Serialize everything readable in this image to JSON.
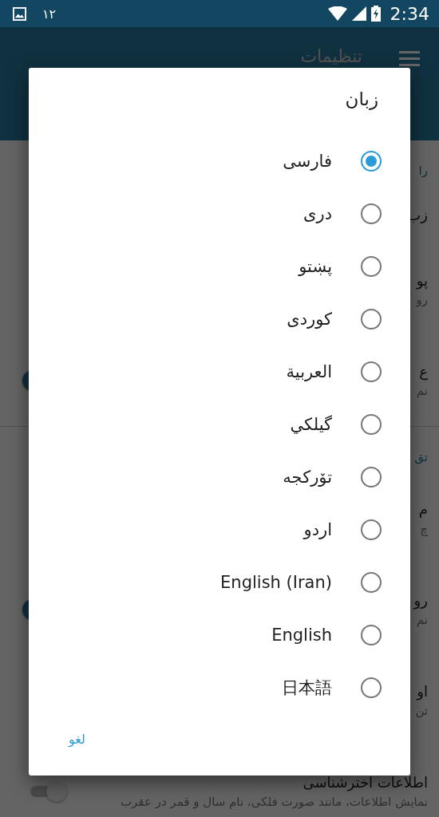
{
  "status_bar": {
    "notification_count": "۱۲",
    "time": "2:34"
  },
  "app_bar": {
    "title": "تنظیمات"
  },
  "settings": [
    {
      "header": "را",
      "items": [
        {
          "title": "زب"
        },
        {
          "title": "پو",
          "summary": "رو"
        },
        {
          "title": "ع",
          "summary": "نم",
          "toggle": {
            "on": true
          }
        }
      ]
    },
    {
      "header": "تق",
      "items": [
        {
          "title": "م",
          "summary": "چ"
        },
        {
          "title": "رو",
          "summary": "نم",
          "toggle": {
            "on": true
          }
        },
        {
          "title": "او",
          "summary": "تن"
        },
        {
          "title": "اطلاعات اخترشناسی",
          "summary": "نمایش اطلاعات، مانند صورت فلکی، نام سال و قمر در عقرب",
          "toggle": {
            "on": false
          }
        }
      ]
    }
  ],
  "dialog": {
    "title": "زبان",
    "options": [
      {
        "label": "فارسی",
        "selected": true
      },
      {
        "label": "دری",
        "selected": false
      },
      {
        "label": "پښتو",
        "selected": false
      },
      {
        "label": "کوردی",
        "selected": false
      },
      {
        "label": "العربية",
        "selected": false
      },
      {
        "label": "گیلکي",
        "selected": false
      },
      {
        "label": "تۆرکجه",
        "selected": false
      },
      {
        "label": "اردو",
        "selected": false
      },
      {
        "label": "English (Iran)",
        "selected": false
      },
      {
        "label": "English",
        "selected": false
      },
      {
        "label": "日本語",
        "selected": false
      }
    ],
    "cancel": "لغو"
  }
}
